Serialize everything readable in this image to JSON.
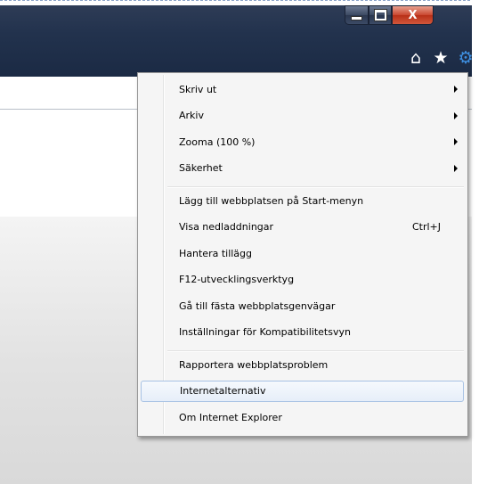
{
  "window": {
    "minimize_icon": "minimize-icon",
    "maximize_icon": "maximize-icon",
    "close_glyph": "X"
  },
  "toolbar": {
    "home_glyph": "⌂",
    "favorites_glyph": "★",
    "tools_glyph": "⚙"
  },
  "menu": {
    "groups": [
      [
        {
          "label": "Skriv ut",
          "submenu": true
        },
        {
          "label": "Arkiv",
          "submenu": true
        },
        {
          "label": "Zooma (100 %)",
          "submenu": true
        },
        {
          "label": "Säkerhet",
          "submenu": true
        }
      ],
      [
        {
          "label": "Lägg till webbplatsen på Start-menyn"
        },
        {
          "label": "Visa nedladdningar",
          "shortcut": "Ctrl+J"
        },
        {
          "label": "Hantera tillägg"
        },
        {
          "label": "F12-utvecklingsverktyg"
        },
        {
          "label": "Gå till fästa webbplatsgenvägar"
        },
        {
          "label": "Inställningar för Kompatibilitetsvyn"
        }
      ],
      [
        {
          "label": "Rapportera webbplatsproblem"
        },
        {
          "label": "Internetalternativ",
          "highlighted": true
        },
        {
          "label": "Om Internet Explorer"
        }
      ]
    ]
  },
  "colors": {
    "chrome": "#22324d",
    "menu_background": "#f5f5f5",
    "highlight_border": "#a8c2e4",
    "gear_icon": "#3e8fe0"
  }
}
